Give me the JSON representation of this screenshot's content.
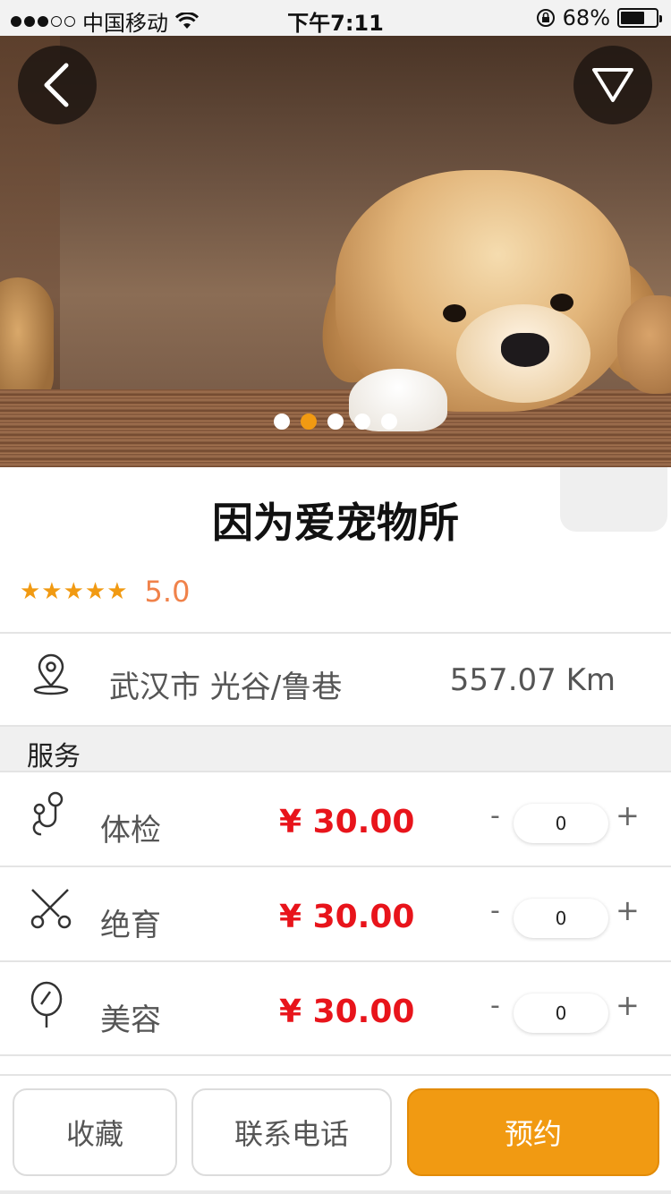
{
  "status_bar": {
    "carrier": "中国移动",
    "time": "下午7:11",
    "battery_pct": "68%",
    "battery_level": 0.68
  },
  "carousel": {
    "dot_count": 5,
    "active_index": 1,
    "image_desc": "puppy-photo"
  },
  "shop": {
    "name": "因为爱宠物所",
    "stars": "★★★★★",
    "rating": "5.0",
    "location": "武汉市 光谷/鲁巷",
    "distance": "557.07 Km"
  },
  "services": {
    "section_label": "服务",
    "minus": "-",
    "plus": "+",
    "items": [
      {
        "name": "体检",
        "price": "¥ 30.00",
        "qty": "0",
        "icon": "stethoscope-icon"
      },
      {
        "name": "绝育",
        "price": "¥ 30.00",
        "qty": "0",
        "icon": "scissors-icon"
      },
      {
        "name": "美容",
        "price": "¥ 30.00",
        "qty": "0",
        "icon": "mirror-icon"
      }
    ]
  },
  "actions": {
    "favorite": "收藏",
    "contact": "联系电话",
    "book": "预约"
  },
  "colors": {
    "accent": "#f19a12",
    "price": "#e8141b",
    "rating": "#f0824a"
  }
}
